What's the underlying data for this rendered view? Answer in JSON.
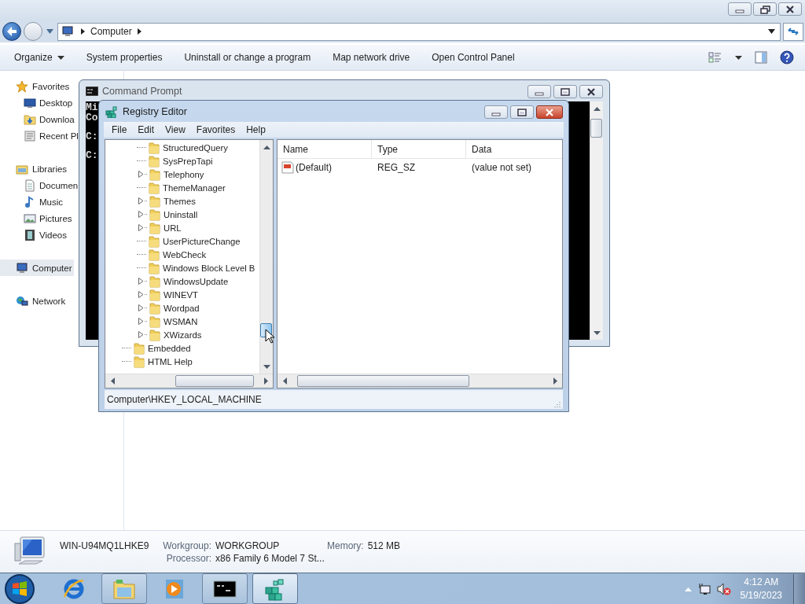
{
  "explorer": {
    "address": {
      "crumbs": [
        "Computer"
      ]
    },
    "toolbar": [
      {
        "label": "Organize",
        "dropdown": true
      },
      {
        "label": "System properties",
        "dropdown": false
      },
      {
        "label": "Uninstall or change a program",
        "dropdown": false
      },
      {
        "label": "Map network drive",
        "dropdown": false
      },
      {
        "label": "Open Control Panel",
        "dropdown": false
      }
    ],
    "nav": [
      {
        "label": "Favorites",
        "selected": false,
        "children": [
          {
            "label": "Desktop",
            "selected": false
          },
          {
            "label": "Downloa",
            "selected": false
          },
          {
            "label": "Recent Pl",
            "selected": false
          }
        ]
      },
      {
        "label": "Libraries",
        "selected": false,
        "children": [
          {
            "label": "Documen",
            "selected": false
          },
          {
            "label": "Music",
            "selected": false
          },
          {
            "label": "Pictures",
            "selected": false
          },
          {
            "label": "Videos",
            "selected": false
          }
        ]
      },
      {
        "label": "Computer",
        "selected": true
      },
      {
        "label": "Network",
        "selected": false
      }
    ],
    "details": {
      "computer_name": "WIN-U94MQ1LHKE9",
      "fields": [
        {
          "label": "Workgroup:",
          "value": "WORKGROUP"
        },
        {
          "label": "Memory:",
          "value": "512 MB"
        },
        {
          "label": "Processor:",
          "value": "x86 Family 6 Model 7 St..."
        }
      ]
    }
  },
  "command_prompt": {
    "title": "Command Prompt",
    "lines": [
      "Mi",
      "Co",
      "C:",
      "C:"
    ]
  },
  "registry_editor": {
    "title": "Registry Editor",
    "menu": [
      "File",
      "Edit",
      "View",
      "Favorites",
      "Help"
    ],
    "tree": [
      {
        "children": [
          {
            "label": "StructuredQuery",
            "expandable": false
          },
          {
            "label": "SysPrepTapi",
            "expandable": false
          },
          {
            "label": "Telephony",
            "expandable": true
          },
          {
            "label": "ThemeManager",
            "expandable": false
          },
          {
            "label": "Themes",
            "expandable": true
          },
          {
            "label": "Uninstall",
            "expandable": true
          },
          {
            "label": "URL",
            "expandable": true
          },
          {
            "label": "UserPictureChange",
            "expandable": false
          },
          {
            "label": "WebCheck",
            "expandable": false
          },
          {
            "label": "Windows Block Level B",
            "expandable": false
          },
          {
            "label": "WindowsUpdate",
            "expandable": true
          },
          {
            "label": "WINEVT",
            "expandable": true
          },
          {
            "label": "Wordpad",
            "expandable": true
          },
          {
            "label": "WSMAN",
            "expandable": true
          },
          {
            "label": "XWizards",
            "expandable": true
          }
        ]
      },
      {
        "label": "Embedded",
        "expandable": false
      },
      {
        "label": "HTML Help",
        "expandable": false
      }
    ],
    "columns": [
      "Name",
      "Type",
      "Data"
    ],
    "rows": [
      {
        "name": "(Default)",
        "type": "REG_SZ",
        "data": "(value not set)"
      }
    ],
    "status": "Computer\\HKEY_LOCAL_MACHINE"
  },
  "taskbar": {
    "buttons": [
      {
        "running": false,
        "selected": false
      },
      {
        "running": true,
        "selected": false
      },
      {
        "running": false,
        "selected": false
      },
      {
        "running": true,
        "selected": false
      },
      {
        "running": true,
        "selected": true
      }
    ]
  },
  "tray": {
    "volume_muted": true,
    "time": "4:12 AM",
    "date": "5/19/2023"
  }
}
